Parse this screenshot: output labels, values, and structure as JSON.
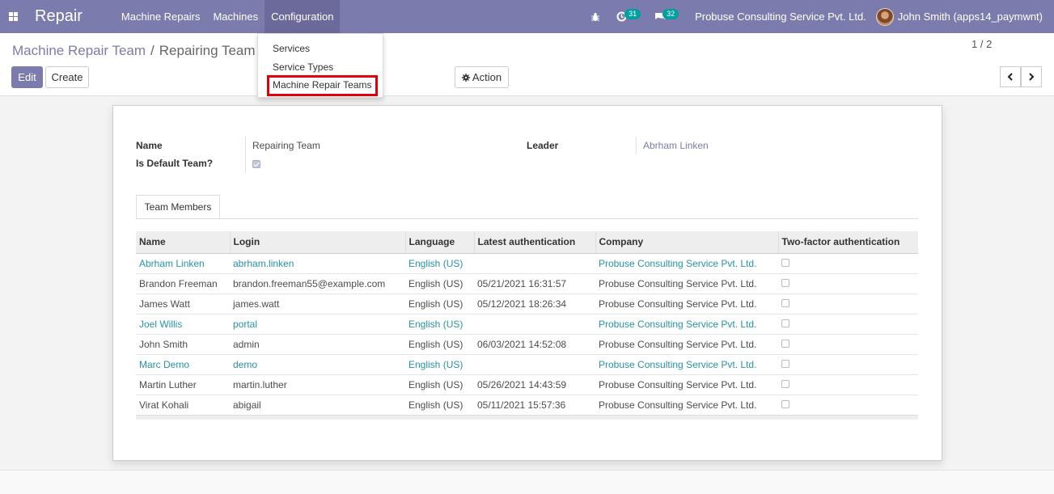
{
  "navbar": {
    "app_name": "Repair",
    "menu": [
      "Machine Repairs",
      "Machines",
      "Configuration"
    ],
    "activity_count": "31",
    "message_count": "32",
    "company": "Probuse Consulting Service Pvt. Ltd.",
    "user": "John Smith (apps14_paymwnt)",
    "accent_color": "#7c7bad"
  },
  "dropdown": {
    "items": [
      "Services",
      "Service Types",
      "Machine Repair Teams"
    ]
  },
  "breadcrumb": {
    "parent": "Machine Repair Team",
    "separator": "/",
    "current": "Repairing Team"
  },
  "buttons": {
    "edit": "Edit",
    "create": "Create",
    "action": "Action"
  },
  "pager": {
    "text": "1 / 2"
  },
  "form": {
    "name_label": "Name",
    "name_value": "Repairing Team",
    "default_label": "Is Default Team?",
    "leader_label": "Leader",
    "leader_value": "Abrham Linken"
  },
  "tab": {
    "label": "Team Members"
  },
  "table": {
    "columns": [
      "Name",
      "Login",
      "Language",
      "Latest authentication",
      "Company",
      "Two-factor authentication"
    ],
    "rows": [
      {
        "name": "Abrham Linken",
        "login": "abrham.linken",
        "language": "English (US)",
        "auth": "",
        "company": "Probuse Consulting Service Pvt. Ltd.",
        "linked": true
      },
      {
        "name": "Brandon Freeman",
        "login": "brandon.freeman55@example.com",
        "language": "English (US)",
        "auth": "05/21/2021 16:31:57",
        "company": "Probuse Consulting Service Pvt. Ltd.",
        "linked": false
      },
      {
        "name": "James Watt",
        "login": "james.watt",
        "language": "English (US)",
        "auth": "05/12/2021 18:26:34",
        "company": "Probuse Consulting Service Pvt. Ltd.",
        "linked": false
      },
      {
        "name": "Joel Willis",
        "login": "portal",
        "language": "English (US)",
        "auth": "",
        "company": "Probuse Consulting Service Pvt. Ltd.",
        "linked": true
      },
      {
        "name": "John Smith",
        "login": "admin",
        "language": "English (US)",
        "auth": "06/03/2021 14:52:08",
        "company": "Probuse Consulting Service Pvt. Ltd.",
        "linked": false
      },
      {
        "name": "Marc Demo",
        "login": "demo",
        "language": "English (US)",
        "auth": "",
        "company": "Probuse Consulting Service Pvt. Ltd.",
        "linked": true
      },
      {
        "name": "Martin Luther",
        "login": "martin.luther",
        "language": "English (US)",
        "auth": "05/26/2021 14:43:59",
        "company": "Probuse Consulting Service Pvt. Ltd.",
        "linked": false
      },
      {
        "name": "Virat Kohali",
        "login": "abigail",
        "language": "English (US)",
        "auth": "05/11/2021 15:57:36",
        "company": "Probuse Consulting Service Pvt. Ltd.",
        "linked": false
      }
    ]
  }
}
